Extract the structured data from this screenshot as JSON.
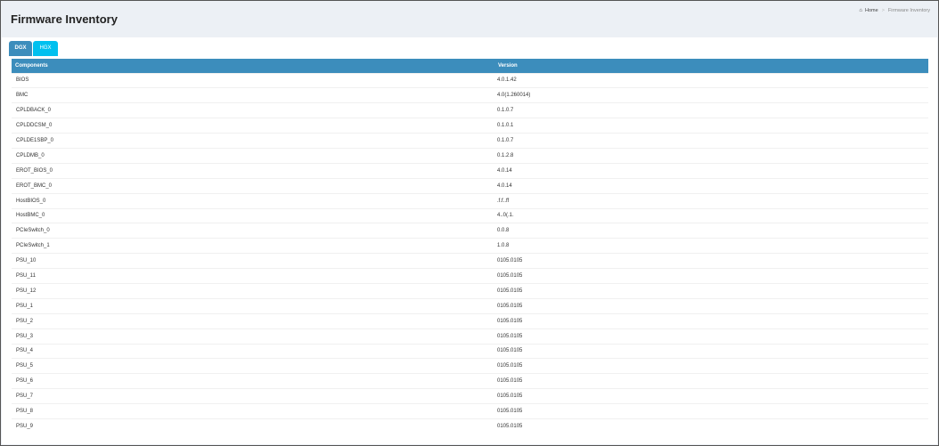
{
  "header": {
    "title": "Firmware Inventory"
  },
  "breadcrumb": {
    "home_icon": "home-icon",
    "home_label": "Home",
    "separator": ">",
    "current": "Firmware Inventory"
  },
  "tabs": [
    {
      "label": "DGX",
      "active": true
    },
    {
      "label": "HGX",
      "active": false
    }
  ],
  "colors": {
    "primary": "#3c8dbc",
    "info": "#00c0ef",
    "background": "#ecf0f5"
  },
  "table": {
    "columns": [
      "Components",
      "Version"
    ],
    "rows": [
      [
        "BIOS",
        "4.0.1.42"
      ],
      [
        "BMC",
        "4.0(1.260014)"
      ],
      [
        "CPLDBACK_0",
        "0.1.0.7"
      ],
      [
        "CPLDDCSM_0",
        "0.1.0.1"
      ],
      [
        "CPLDE1SBP_0",
        "0.1.0.7"
      ],
      [
        "CPLDMB_0",
        "0.1.2.8"
      ],
      [
        "EROT_BIOS_0",
        "4.0.14"
      ],
      [
        "EROT_BMC_0",
        "4.0.14"
      ],
      [
        "HostBIOS_0",
        ".f.f..ff"
      ],
      [
        "HostBMC_0",
        "4..0(.1."
      ],
      [
        "PCIeSwitch_0",
        "0.0.8"
      ],
      [
        "PCIeSwitch_1",
        "1.0.8"
      ],
      [
        "PSU_10",
        "0105.0105"
      ],
      [
        "PSU_11",
        "0105.0105"
      ],
      [
        "PSU_12",
        "0105.0105"
      ],
      [
        "PSU_1",
        "0105.0105"
      ],
      [
        "PSU_2",
        "0105.0105"
      ],
      [
        "PSU_3",
        "0105.0105"
      ],
      [
        "PSU_4",
        "0105.0105"
      ],
      [
        "PSU_5",
        "0105.0105"
      ],
      [
        "PSU_6",
        "0105.0105"
      ],
      [
        "PSU_7",
        "0105.0105"
      ],
      [
        "PSU_8",
        "0105.0105"
      ],
      [
        "PSU_9",
        "0105.0105"
      ]
    ]
  }
}
